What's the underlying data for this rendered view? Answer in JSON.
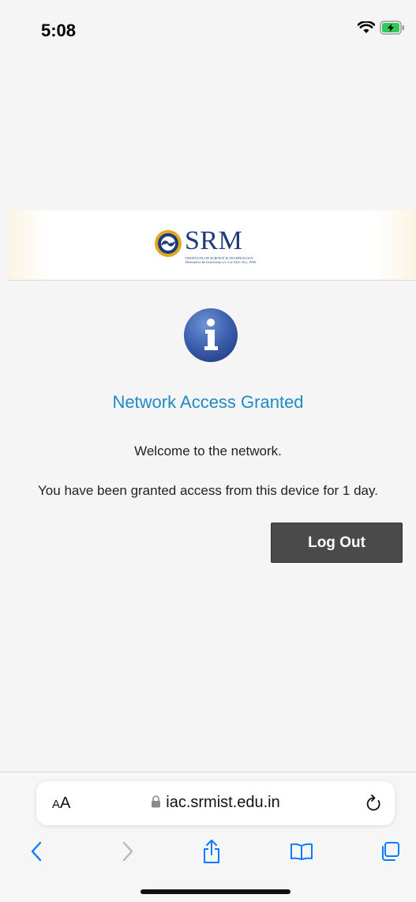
{
  "status_bar": {
    "time": "5:08",
    "wifi_icon": "wifi-icon",
    "battery_icon": "battery-charging-icon"
  },
  "banner": {
    "logo_text": "SRM",
    "logo_subtext_line1": "INSTITUTE OF SCIENCE & TECHNOLOGY",
    "logo_subtext_line2": "Deemed to be University u/s 3 of UGC Act, 1956",
    "logo_icon": "srm-emblem-icon"
  },
  "main": {
    "icon": "info-icon",
    "title": "Network Access Granted",
    "welcome": "Welcome to the network.",
    "message": "You have been granted access from this device for 1 day.",
    "logout_label": "Log Out"
  },
  "browser": {
    "aa_label_small": "A",
    "aa_label_large": "A",
    "url": "iac.srmist.edu.in",
    "lock_icon": "lock-icon",
    "reload_icon": "reload-icon",
    "nav": [
      "back-icon",
      "forward-icon",
      "share-icon",
      "bookmarks-icon",
      "tabs-icon"
    ]
  },
  "colors": {
    "accent": "#1f8ac6",
    "button_bg": "#4a4a4a",
    "logo_blue": "#1d3a7a",
    "ios_blue": "#0a7aff"
  }
}
